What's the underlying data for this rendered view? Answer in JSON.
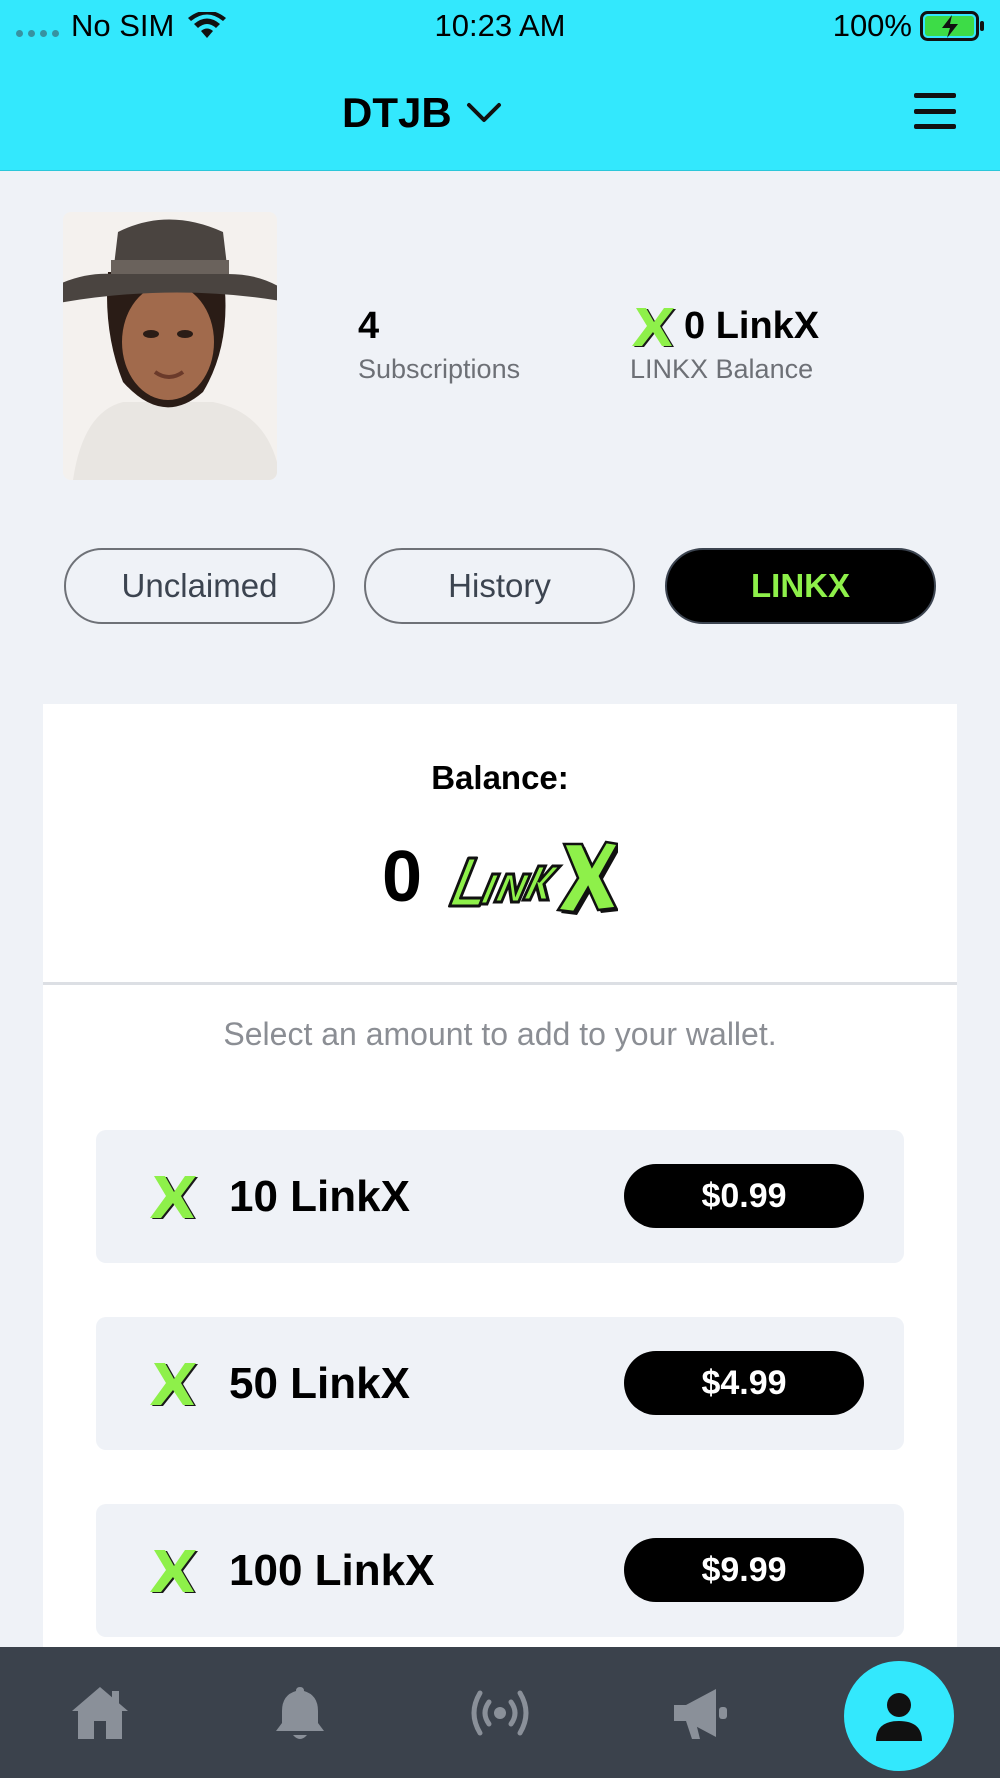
{
  "status_bar": {
    "carrier": "No SIM",
    "time": "10:23 AM",
    "battery": "100%"
  },
  "header": {
    "title": "DTJB"
  },
  "profile": {
    "subscriptions_count": "4",
    "subscriptions_label": "Subscriptions",
    "balance_value": "0 LinkX",
    "balance_label": "LINKX Balance"
  },
  "tabs": [
    {
      "label": "Unclaimed",
      "active": false
    },
    {
      "label": "History",
      "active": false
    },
    {
      "label": "LINKX",
      "active": true
    }
  ],
  "wallet": {
    "balance_label": "Balance:",
    "balance_value": "0",
    "hint": "Select an amount to add to your wallet.",
    "packages": [
      {
        "amount": "10 LinkX",
        "price": "$0.99"
      },
      {
        "amount": "50 LinkX",
        "price": "$4.99"
      },
      {
        "amount": "100 LinkX",
        "price": "$9.99"
      }
    ]
  },
  "nav": {
    "items": [
      "home-icon",
      "bell-icon",
      "broadcast-icon",
      "megaphone-icon",
      "profile-icon"
    ],
    "active": "profile-icon"
  },
  "colors": {
    "header_bg": "#33e8fd",
    "accent_green": "#8ef04a",
    "nav_bg": "#3b424c",
    "page_bg": "#eff2f7"
  }
}
